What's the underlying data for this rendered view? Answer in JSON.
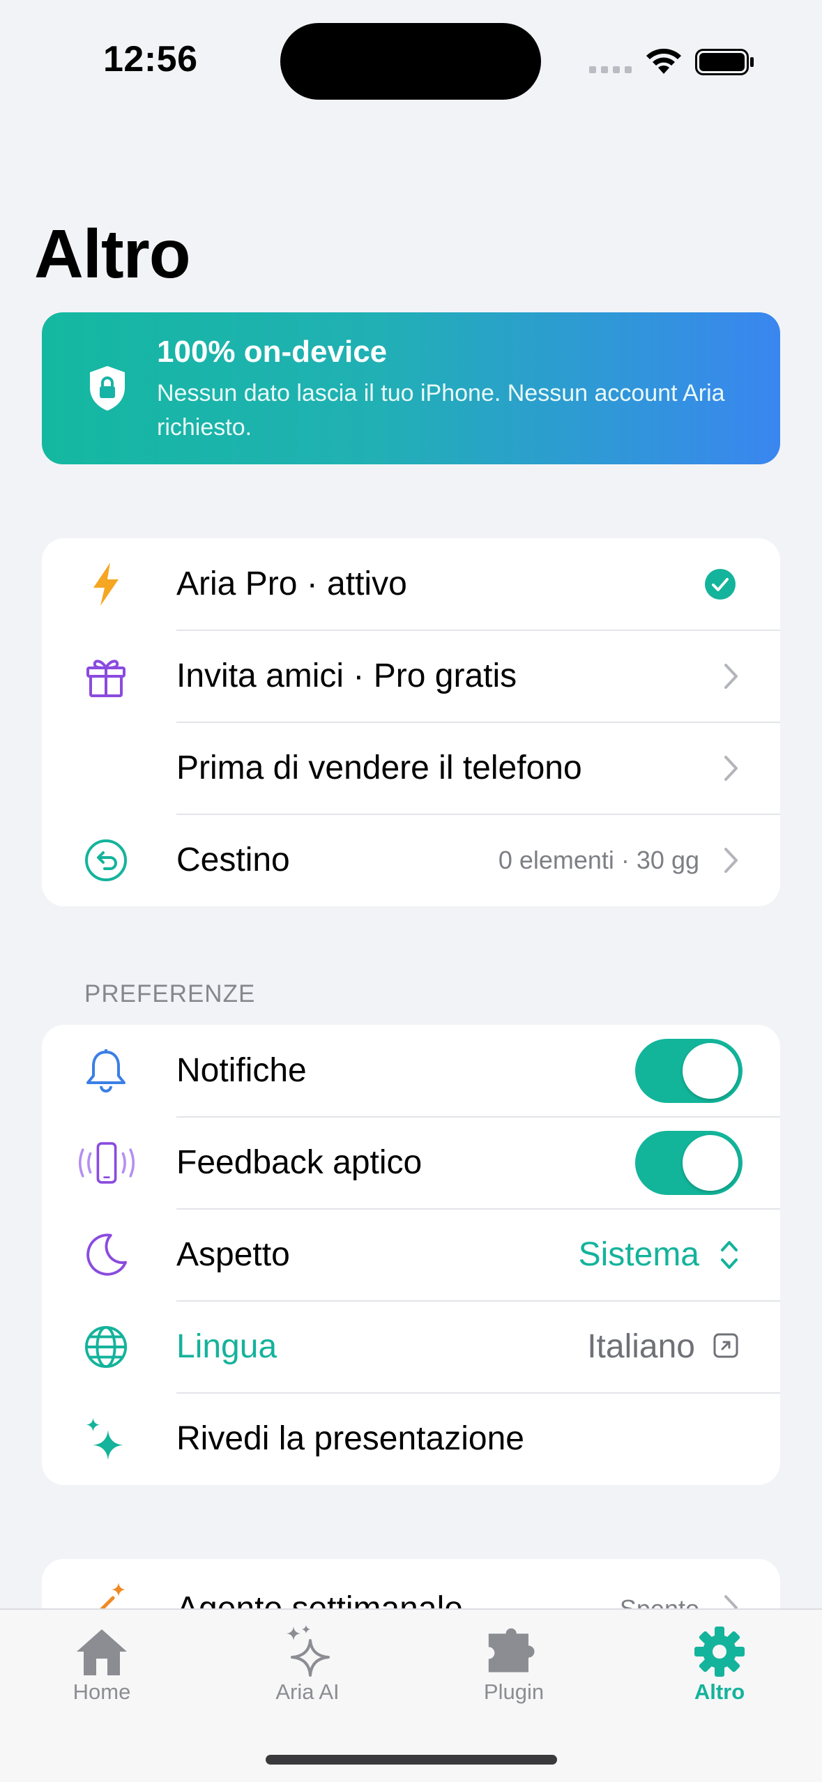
{
  "status_bar": {
    "time": "12:56"
  },
  "page": {
    "title": "Altro"
  },
  "banner": {
    "title": "100% on-device",
    "text": "Nessun dato lascia il tuo iPhone. Nessun account Aria richiesto.",
    "icon": "shield-lock-icon"
  },
  "account_section": {
    "items": [
      {
        "label": "Aria Pro · attivo",
        "icon": "bolt-icon",
        "accessory": "checkmark-circle-icon"
      },
      {
        "label": "Invita amici · Pro gratis",
        "icon": "gift-icon",
        "accessory": "chevron-right-icon"
      },
      {
        "label": "Prima di vendere il telefono",
        "icon": "",
        "accessory": "chevron-right-icon"
      },
      {
        "label": "Cestino",
        "icon": "trash-restore-icon",
        "detail": "0 elementi · 30 gg",
        "accessory": "chevron-right-icon"
      }
    ]
  },
  "preferences": {
    "header": "PREFERENZE",
    "items": [
      {
        "label": "Notifiche",
        "icon": "bell-icon",
        "toggle_on": true
      },
      {
        "label": "Feedback aptico",
        "icon": "phone-vibrate-icon",
        "toggle_on": true
      },
      {
        "label": "Aspetto",
        "icon": "moon-icon",
        "value": "Sistema"
      },
      {
        "label": "Lingua",
        "icon": "globe-icon",
        "value": "Italiano"
      },
      {
        "label": "Rivedi la presentazione",
        "icon": "sparkles-icon"
      }
    ]
  },
  "next_section": {
    "items": [
      {
        "label": "Agente settimanale",
        "icon": "magic-wand-icon",
        "detail": "Spento"
      }
    ]
  },
  "tabbar": {
    "tabs": [
      {
        "label": "Home",
        "icon": "house-icon",
        "active": false
      },
      {
        "label": "Aria AI",
        "icon": "sparkles-icon",
        "active": false
      },
      {
        "label": "Plugin",
        "icon": "puzzle-icon",
        "active": false
      },
      {
        "label": "Altro",
        "icon": "gear-icon",
        "active": true
      }
    ]
  },
  "colors": {
    "accent": "#14b39b",
    "background": "#f2f3f6",
    "banner_start": "#14b8a0",
    "banner_end": "#3a86f0",
    "bolt": "#f5a623",
    "purple": "#8a4bdf",
    "blue": "#3b7fe6"
  }
}
